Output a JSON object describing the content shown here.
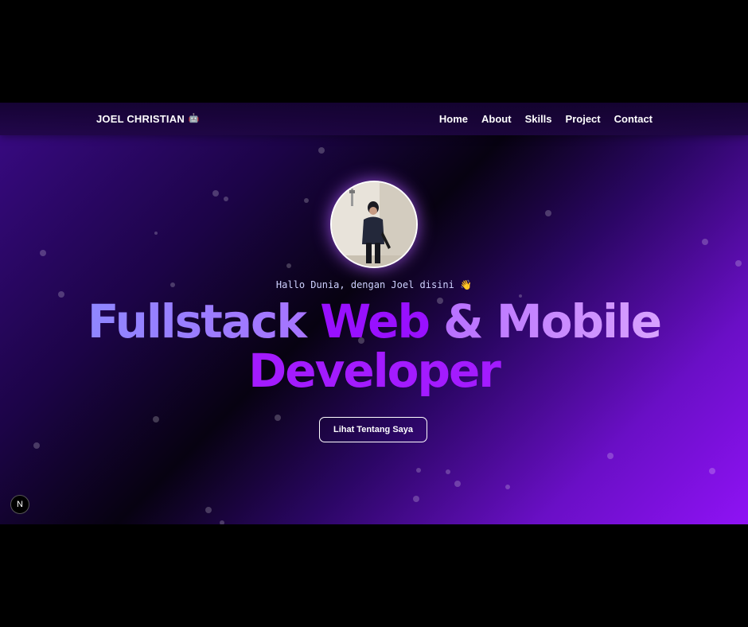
{
  "navbar": {
    "brand": "JOEL CHRISTIAN",
    "brand_icon": "robot-emoji",
    "links": [
      "Home",
      "About",
      "Skills",
      "Project",
      "Contact"
    ]
  },
  "hero": {
    "avatar_alt": "person-photo",
    "greeting": "Hallo Dunia, dengan Joel disini 👋",
    "headline": {
      "part_a": "Fullstack ",
      "part_b": "Web",
      "part_c": " & Mobile",
      "line2": "Developer"
    },
    "cta_label": "Lihat Tentang Saya"
  },
  "dev_badge": "N",
  "colors": {
    "accent": "#9810ff",
    "headline_light": "#8f86ff",
    "headline_pink": "#d8a2ff",
    "nav_bg": "#1a0440",
    "greeting": "#cfd2ff"
  }
}
